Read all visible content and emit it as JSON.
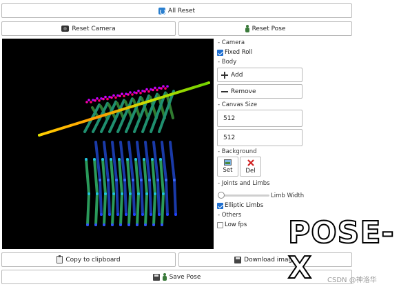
{
  "toolbar": {
    "all_reset": "All Reset",
    "reset_camera": "Reset Camera",
    "reset_pose": "Reset Pose"
  },
  "panel": {
    "camera_header": "- Camera",
    "fixed_roll": "Fixed Roll",
    "fixed_roll_checked": true,
    "body_header": "- Body",
    "add": "Add",
    "remove": "Remove",
    "canvas_size_header": "- Canvas Size",
    "width": "512",
    "height": "512",
    "background_header": "- Background",
    "set": "Set",
    "del": "Del",
    "joints_header": "- Joints and Limbs",
    "limb_width": "Limb Width",
    "elliptic_limbs": "Elliptic Limbs",
    "elliptic_checked": true,
    "others_header": "- Others",
    "low_fps": "Low fps",
    "low_fps_checked": false
  },
  "bottom": {
    "copy": "Copy to clipboard",
    "download": "Download image",
    "save": "Save Pose"
  },
  "overlay": {
    "logo": "POSE-X",
    "watermark": "CSDN @神洛华"
  },
  "icons": [
    "reset-icon",
    "camera-icon",
    "person-icon",
    "plus-icon",
    "minus-icon",
    "image-icon",
    "close-icon",
    "clipboard-icon",
    "save-icon"
  ],
  "colors": {
    "checkbox_accent": "#1f6fd0",
    "delete_red": "#d02020",
    "canvas_bg": "#000000"
  }
}
